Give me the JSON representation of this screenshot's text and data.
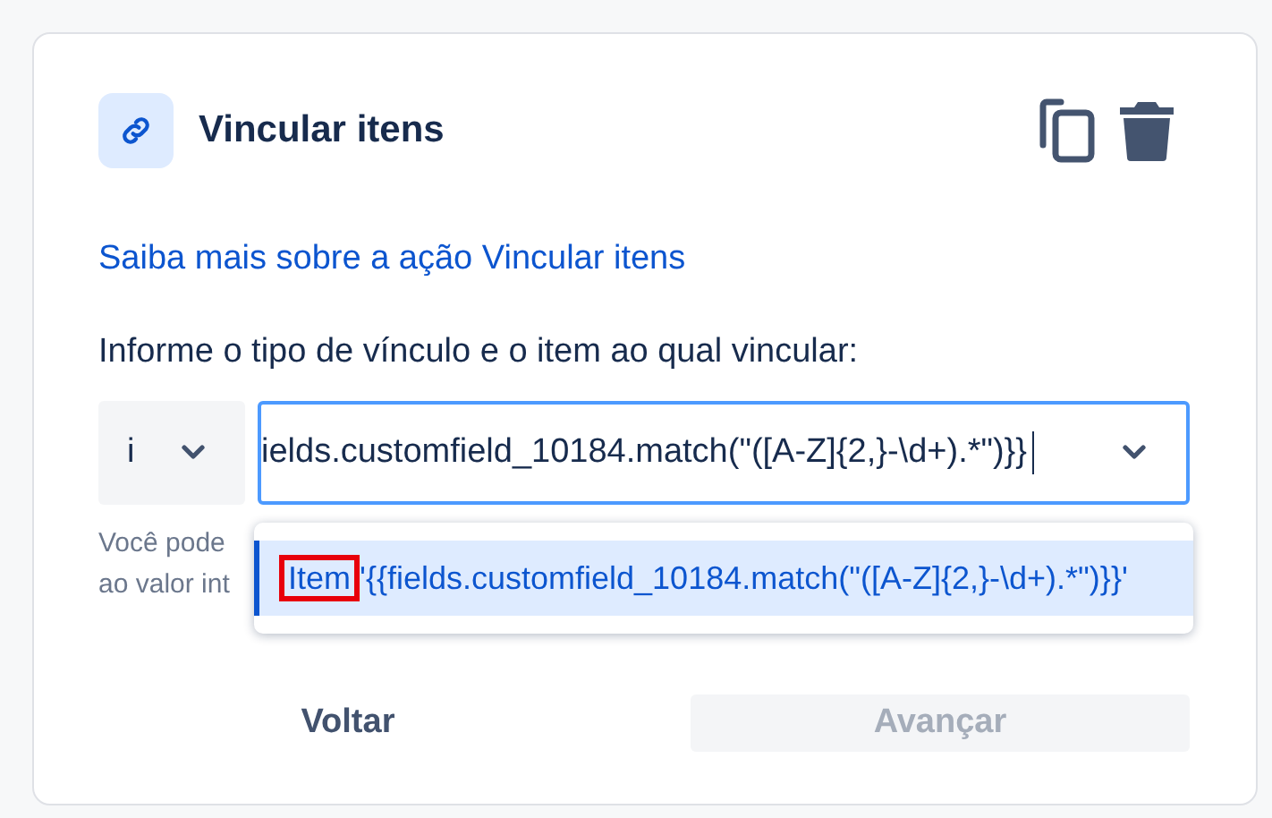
{
  "card": {
    "title": "Vincular itens",
    "learn_more_link": "Saiba mais sobre a ação Vincular itens",
    "prompt": "Informe o tipo de vínculo e o item ao qual vincular:"
  },
  "link_type_select": {
    "value": "i"
  },
  "item_field": {
    "value": "ields.customfield_10184.match(\"([A-Z]{2,}-\\d+).*\")}}",
    "focused": true
  },
  "helper_text": [
    "Você pode",
    "ao valor int"
  ],
  "dropdown": {
    "options": [
      {
        "label": "Item",
        "value": "'{{fields.customfield_10184.match(\"([A-Z]{2,}-\\d+).*\")}}'",
        "selected": true,
        "annotated": true
      }
    ]
  },
  "buttons": [
    {
      "label": "Voltar",
      "disabled": false
    },
    {
      "label": "Avançar",
      "disabled": true
    }
  ]
}
